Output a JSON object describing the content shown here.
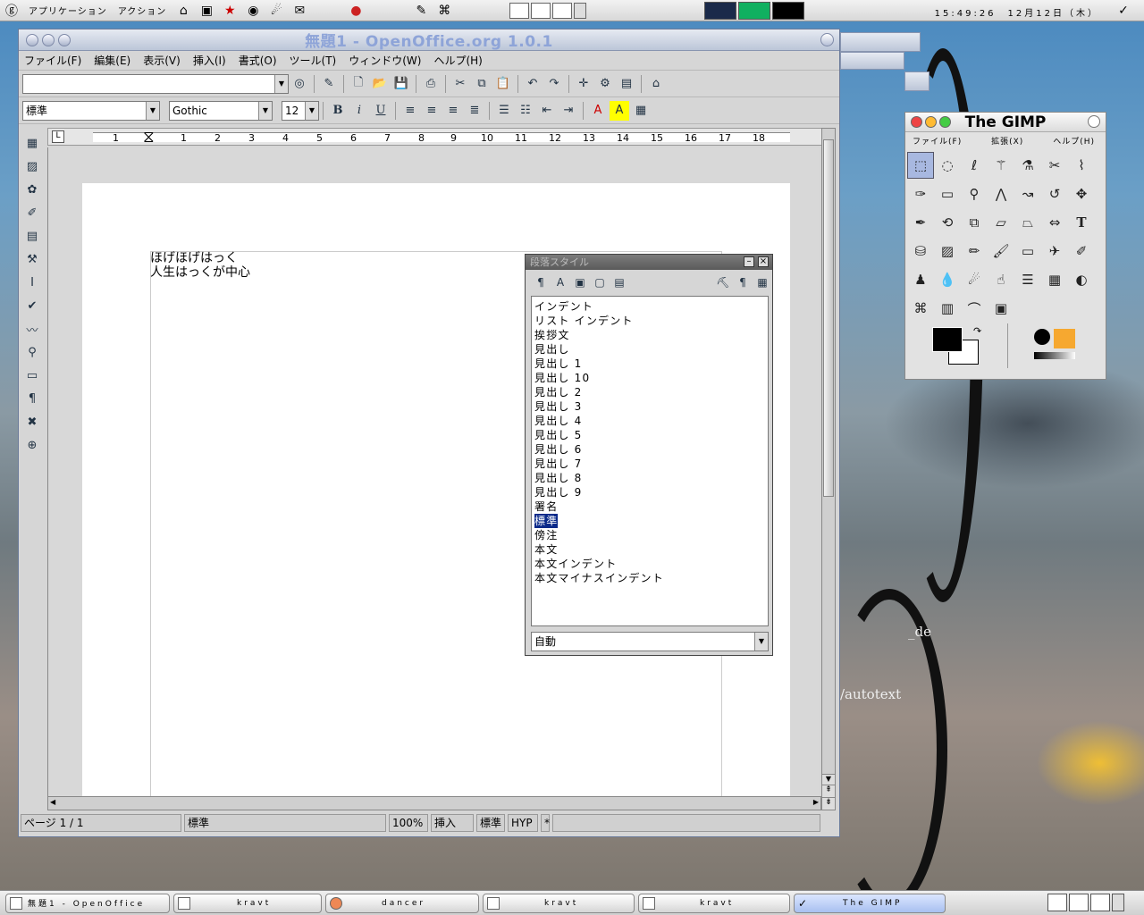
{
  "top_panel": {
    "applications": "アプリケーション",
    "actions": "アクション",
    "clock": "15:49:26　12月12日（木）"
  },
  "oo_window": {
    "title": "無題1 - OpenOffice.org 1.0.1",
    "menu": [
      "ファイル(F)",
      "編集(E)",
      "表示(V)",
      "挿入(I)",
      "書式(O)",
      "ツール(T)",
      "ウィンドウ(W)",
      "ヘルプ(H)"
    ],
    "url_value": "",
    "style_value": "標準",
    "font_value": "Gothic",
    "size_value": "12",
    "ruler_labels": [
      "1",
      "1",
      "2",
      "3",
      "4",
      "5",
      "6",
      "7",
      "8",
      "9",
      "10",
      "11",
      "12",
      "13",
      "14",
      "15",
      "16",
      "17",
      "18"
    ],
    "doc_lines": [
      "ほげほげはっく",
      "人生はっくが中心"
    ],
    "status": {
      "page": "ページ 1 / 1",
      "style": "標準",
      "zoom": "100%",
      "mode": "挿入",
      "sel": "標準",
      "hyp": "HYP",
      "star": "*"
    }
  },
  "para_styles": {
    "title": "段落スタイル",
    "items": [
      "インデント",
      "リスト インデント",
      "挨拶文",
      "見出し",
      "見出し 1",
      "見出し 10",
      "見出し 2",
      "見出し 3",
      "見出し 4",
      "見出し 5",
      "見出し 6",
      "見出し 7",
      "見出し 8",
      "見出し 9",
      "署名",
      "標準",
      "傍注",
      "本文",
      "本文インデント",
      "本文マイナスインデント"
    ],
    "selected_index": 15,
    "filter_value": "自動"
  },
  "gimp": {
    "title": "The GIMP",
    "menu": [
      "ファイル(F)",
      "拡張(X)",
      "ヘルプ(H)"
    ]
  },
  "desktop": {
    "text1": "_de",
    "text2": "/autotext"
  },
  "taskbar": {
    "tasks": [
      {
        "label": "無題1 - OpenOffice"
      },
      {
        "label": "kravt"
      },
      {
        "label": "dancer"
      },
      {
        "label": "kravt"
      },
      {
        "label": "kravt"
      },
      {
        "label": "The GIMP"
      }
    ]
  }
}
